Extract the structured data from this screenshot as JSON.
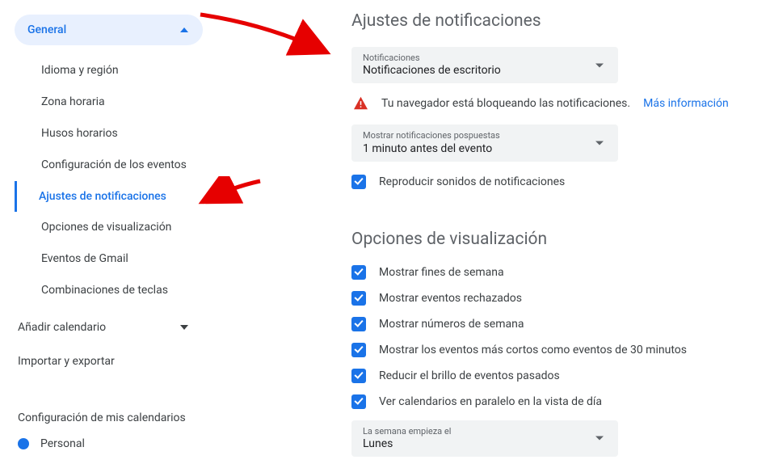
{
  "sidebar": {
    "general_label": "General",
    "items": [
      {
        "label": "Idioma y región"
      },
      {
        "label": "Zona horaria"
      },
      {
        "label": "Husos horarios"
      },
      {
        "label": "Configuración de los eventos"
      },
      {
        "label": "Ajustes de notificaciones",
        "active": true
      },
      {
        "label": "Opciones de visualización"
      },
      {
        "label": "Eventos de Gmail"
      },
      {
        "label": "Combinaciones de teclas"
      }
    ],
    "add_calendar_label": "Añadir calendario",
    "import_export_label": "Importar y exportar",
    "my_calendars_heading": "Configuración de mis calendarios",
    "personal_label": "Personal"
  },
  "notifications": {
    "section_title": "Ajustes de notificaciones",
    "notif_select": {
      "label": "Notificaciones",
      "value": "Notificaciones de escritorio"
    },
    "blocked_warning": "Tu navegador está bloqueando las notificaciones.",
    "more_info_link": "Más información",
    "snoozed_select": {
      "label": "Mostrar notificaciones pospuestas",
      "value": "1 minuto antes del evento"
    },
    "play_sounds_label": "Reproducir sonidos de notificaciones"
  },
  "display_options": {
    "section_title": "Opciones de visualización",
    "checks": [
      "Mostrar fines de semana",
      "Mostrar eventos rechazados",
      "Mostrar números de semana",
      "Mostrar los eventos más cortos como eventos de 30 minutos",
      "Reducir el brillo de eventos pasados",
      "Ver calendarios en paralelo en la vista de día"
    ],
    "week_start_select": {
      "label": "La semana empieza el",
      "value": "Lunes"
    }
  }
}
